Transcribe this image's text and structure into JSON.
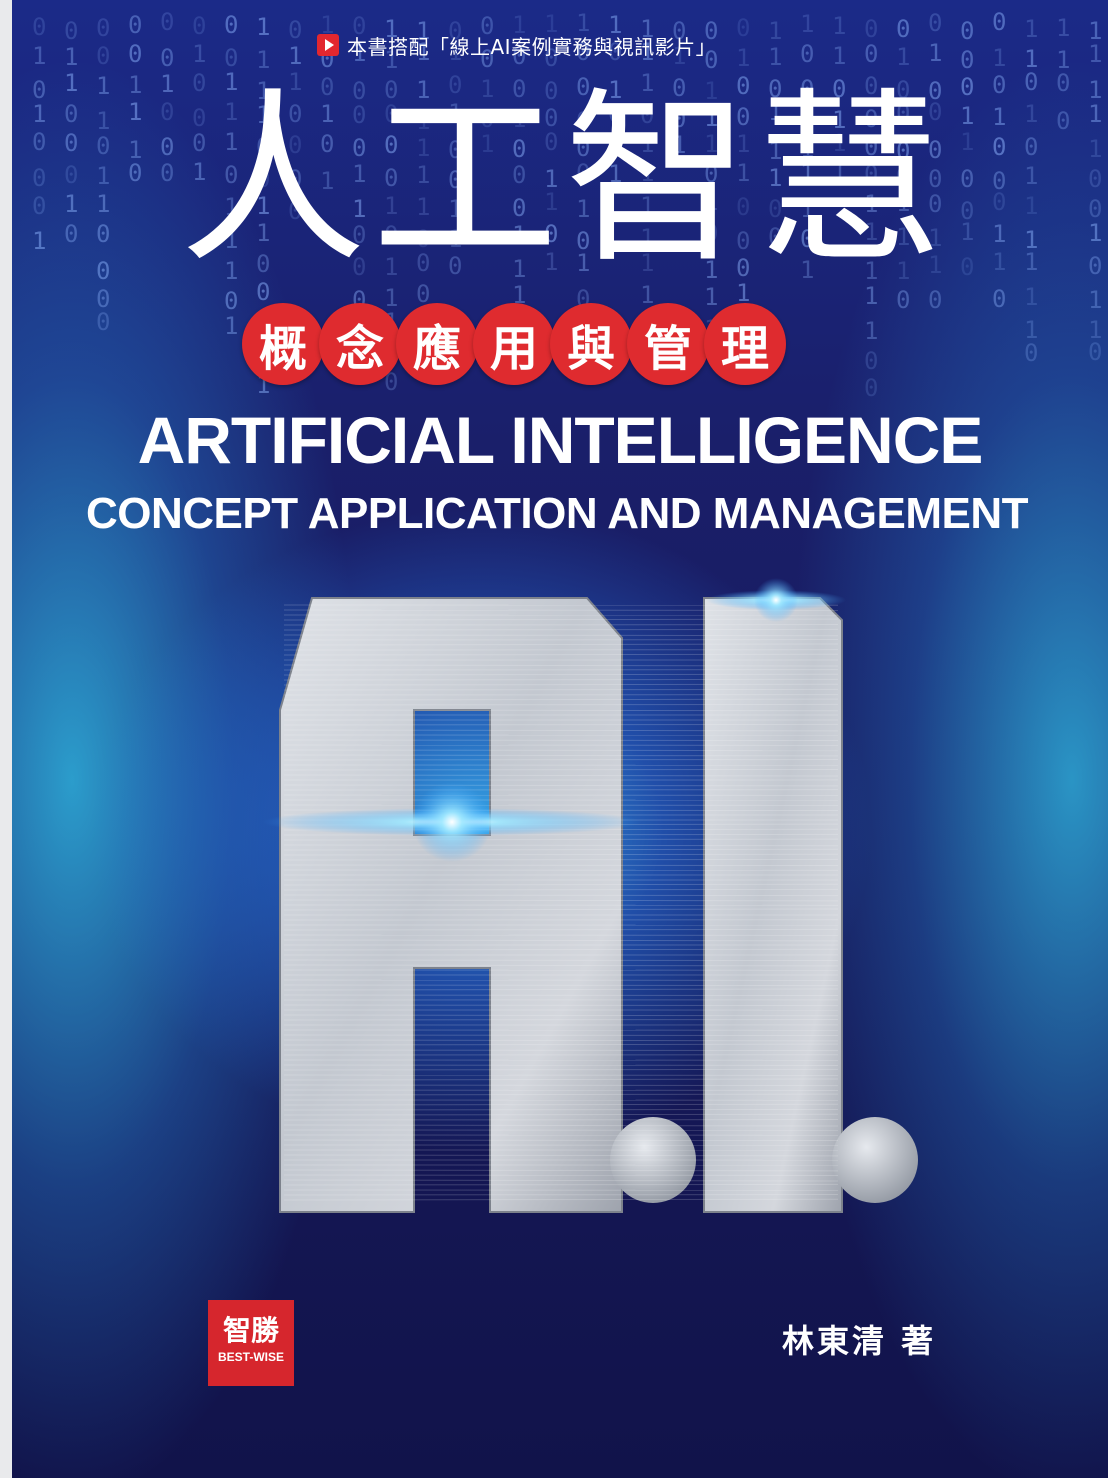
{
  "cover": {
    "promo_text": "本書搭配「線上AI案例實務與視訊影片」",
    "title_zh": "人工智慧",
    "subtitle_zh_chars": [
      "概",
      "念",
      "應",
      "用",
      "與",
      "管",
      "理"
    ],
    "title_en": "ARTIFICIAL INTELLIGENCE",
    "subtitle_en": "CONCEPT APPLICATION AND MANAGEMENT",
    "publisher_zh": "智勝",
    "publisher_en": "BEST-WISE",
    "author": "林東清  著",
    "matrix_glyphs": "0110100101101001",
    "colors": {
      "accent_red": "#df2b2f",
      "background_navy": "#171a5c",
      "glow_cyan": "#3cbeff",
      "metal_silver": "#c9cdd4"
    }
  }
}
